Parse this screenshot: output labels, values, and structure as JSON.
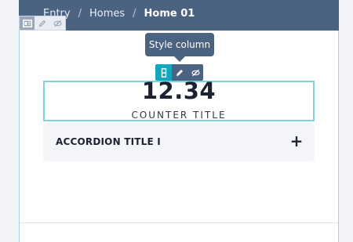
{
  "breadcrumb": {
    "items": [
      "Entry",
      "Homes",
      "Home 01"
    ],
    "separator": "/"
  },
  "row_toolbar": {
    "icons": [
      "layout-icon",
      "edit-icon",
      "hide-icon"
    ]
  },
  "tooltip": {
    "text": "Style column"
  },
  "column_toolbar": {
    "icons": [
      "style-column-icon",
      "edit-icon",
      "hide-icon"
    ]
  },
  "counter": {
    "value": "12.34",
    "title": "COUNTER TITLE"
  },
  "accordion": {
    "title": "ACCORDION TITLE I",
    "toggle": "+"
  },
  "colors": {
    "header": "#4b6280",
    "accent": "#12a7bd",
    "selection_border": "#7fd3dc",
    "accordion_bg": "#f3f5f9"
  }
}
